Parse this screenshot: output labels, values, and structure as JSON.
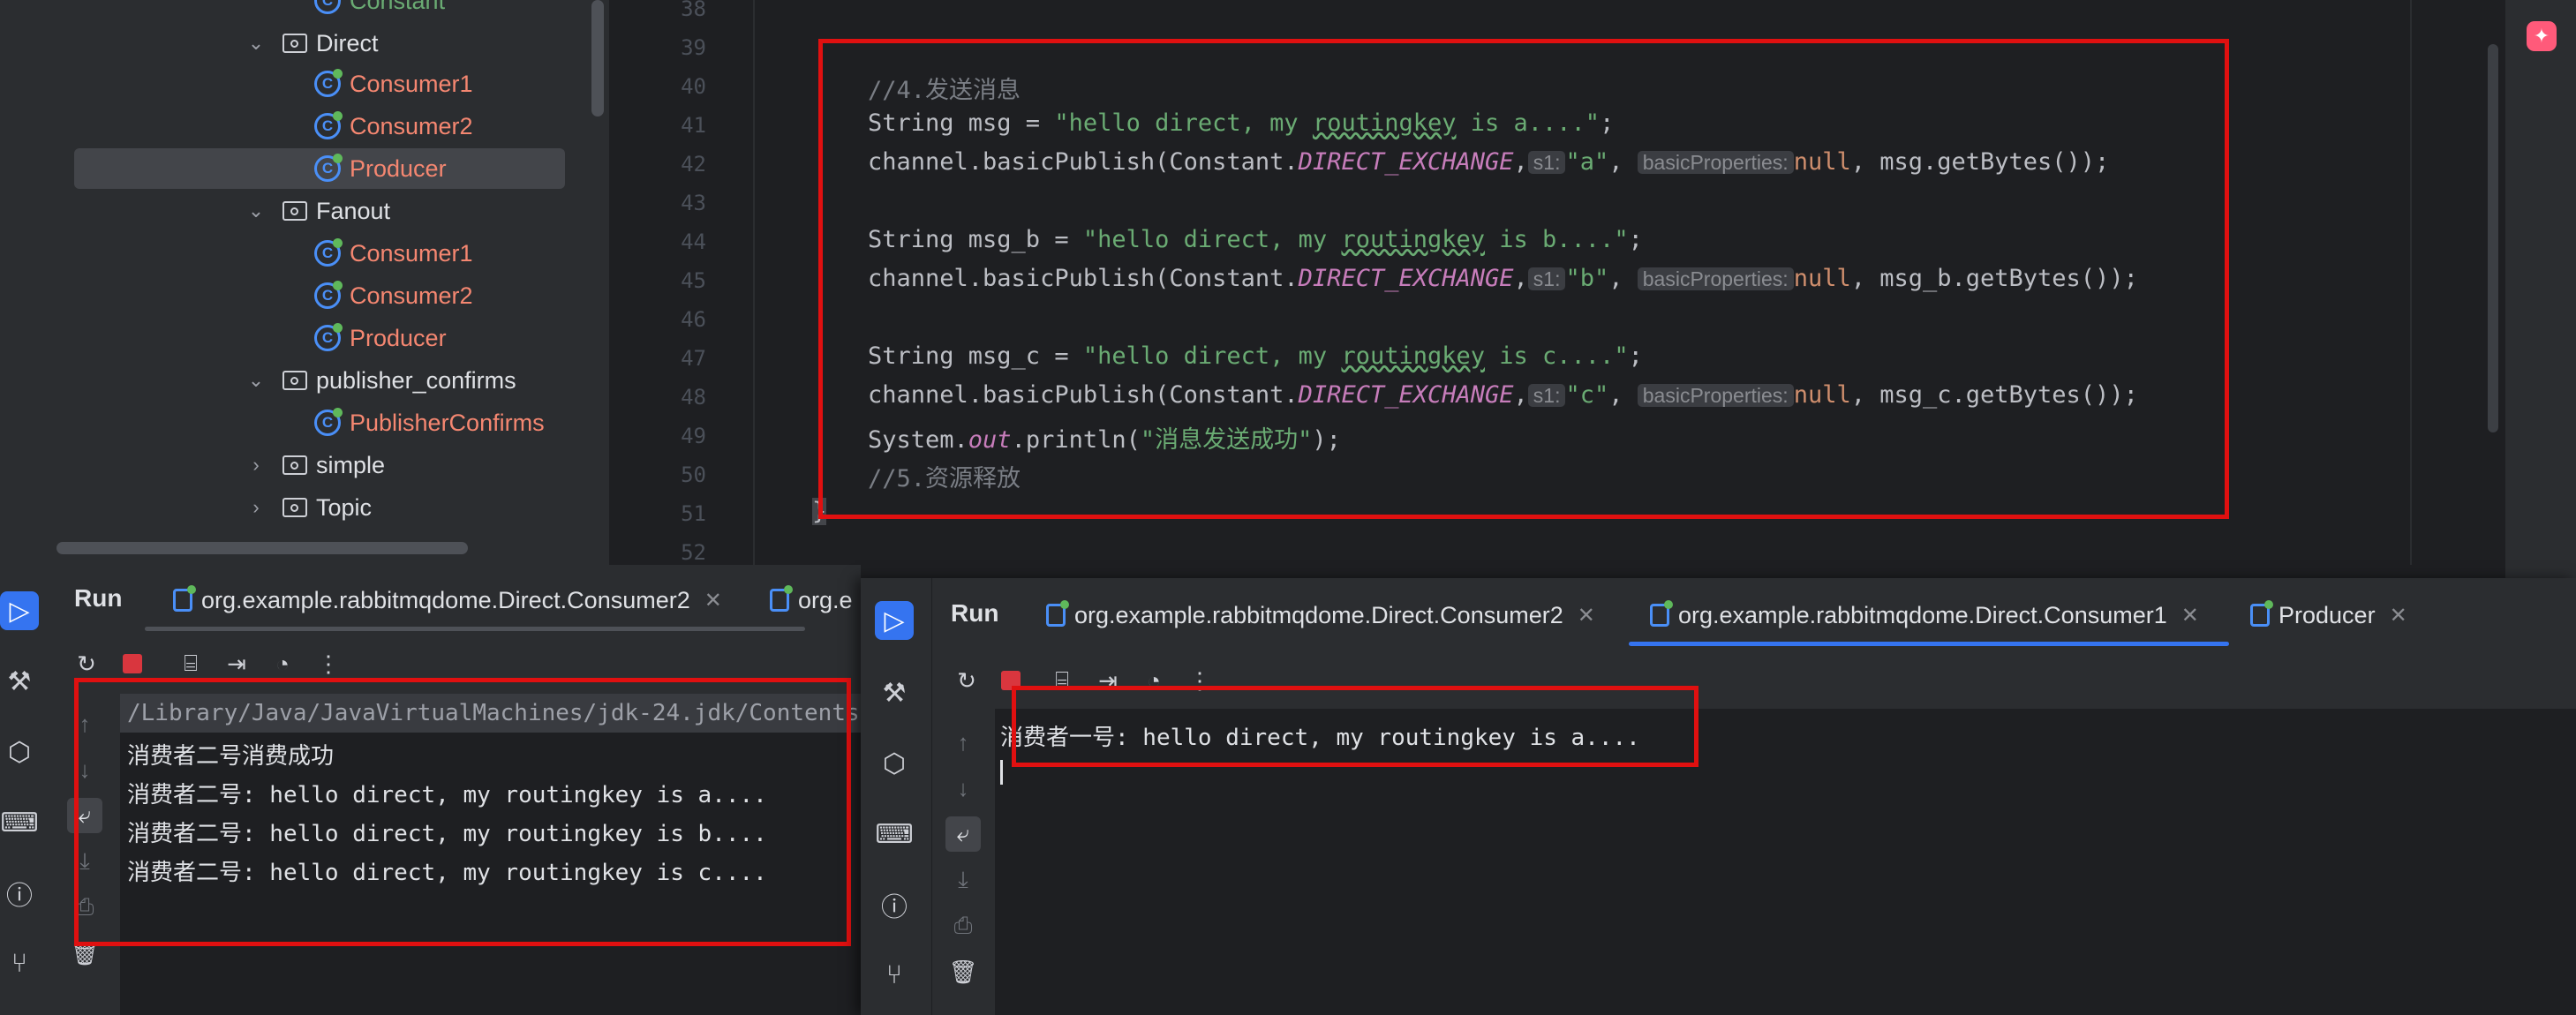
{
  "project_tree": {
    "items": [
      {
        "type": "class",
        "label": "Constant"
      },
      {
        "type": "folder",
        "label": "Direct",
        "expanded": true
      },
      {
        "type": "class",
        "label": "Consumer1"
      },
      {
        "type": "class",
        "label": "Consumer2"
      },
      {
        "type": "class",
        "label": "Producer",
        "selected": true
      },
      {
        "type": "folder",
        "label": "Fanout",
        "expanded": true
      },
      {
        "type": "class",
        "label": "Consumer1"
      },
      {
        "type": "class",
        "label": "Consumer2"
      },
      {
        "type": "class",
        "label": "Producer"
      },
      {
        "type": "folder",
        "label": "publisher_confirms",
        "expanded": true
      },
      {
        "type": "class",
        "label": "PublisherConfirms"
      },
      {
        "type": "folder",
        "label": "simple",
        "expanded": false
      },
      {
        "type": "folder",
        "label": "Topic",
        "expanded": false
      }
    ]
  },
  "editor": {
    "line_numbers": [
      "38",
      "39",
      "40",
      "41",
      "42",
      "43",
      "44",
      "45",
      "46",
      "47",
      "48",
      "49",
      "50",
      "51",
      "52"
    ],
    "code": {
      "l40": "//4.发送消息",
      "l41_a": "String msg = ",
      "l41_str": "\"hello direct, my ",
      "l41_sq": "routingkey",
      "l41_str2": " is a....\"",
      "l41_end": ";",
      "p_prefix": "channel.basicPublish(Constant.",
      "p_const": "DIRECT_EXCHANGE",
      "p_comma": ",",
      "hint_s1": "s1:",
      "hint_bp": "basicProperties:",
      "null_kw": "null",
      "l42_key": "\"a\"",
      "l42_tail": ", msg.getBytes());",
      "l44_a": "String msg_b = ",
      "l44_str2": " is b....\"",
      "l45_key": "\"b\"",
      "l45_tail": ", msg_b.getBytes());",
      "l47_a": "String msg_c = ",
      "l47_str2": " is c....\"",
      "l48_key": "\"c\"",
      "l48_tail": ", msg_c.getBytes());",
      "l49_a": "System.",
      "l49_out": "out",
      "l49_b": ".println(",
      "l49_str": "\"消息发送成功\"",
      "l49_c": ");",
      "l50": "//5.资源释放",
      "l51": "}",
      "comma_sp": ", "
    }
  },
  "run_panel_1": {
    "title": "Run",
    "tabs": [
      {
        "label": "org.example.rabbitmqdome.Direct.Consumer2"
      },
      {
        "label": "org.e"
      }
    ],
    "console_lines": [
      "/Library/Java/JavaVirtualMachines/jdk-24.jdk/Contents",
      "消费者二号消费成功",
      "消费者二号: hello direct, my routingkey is a....",
      "消费者二号: hello direct, my routingkey is b....",
      "消费者二号: hello direct, my routingkey is c...."
    ]
  },
  "run_panel_2": {
    "title": "Run",
    "tabs": [
      {
        "label": "org.example.rabbitmqdome.Direct.Consumer2"
      },
      {
        "label": "org.example.rabbitmqdome.Direct.Consumer1",
        "active": true
      },
      {
        "label": "Producer"
      }
    ],
    "console_lines": [
      "消费者一号: hello direct, my routingkey is a...."
    ]
  },
  "colors": {
    "accent": "#3574f0",
    "highlight_box": "#e01010",
    "string": "#6aab73",
    "keyword": "#cf8e6d",
    "constant": "#c77dbb",
    "class_name": "#f58771"
  }
}
